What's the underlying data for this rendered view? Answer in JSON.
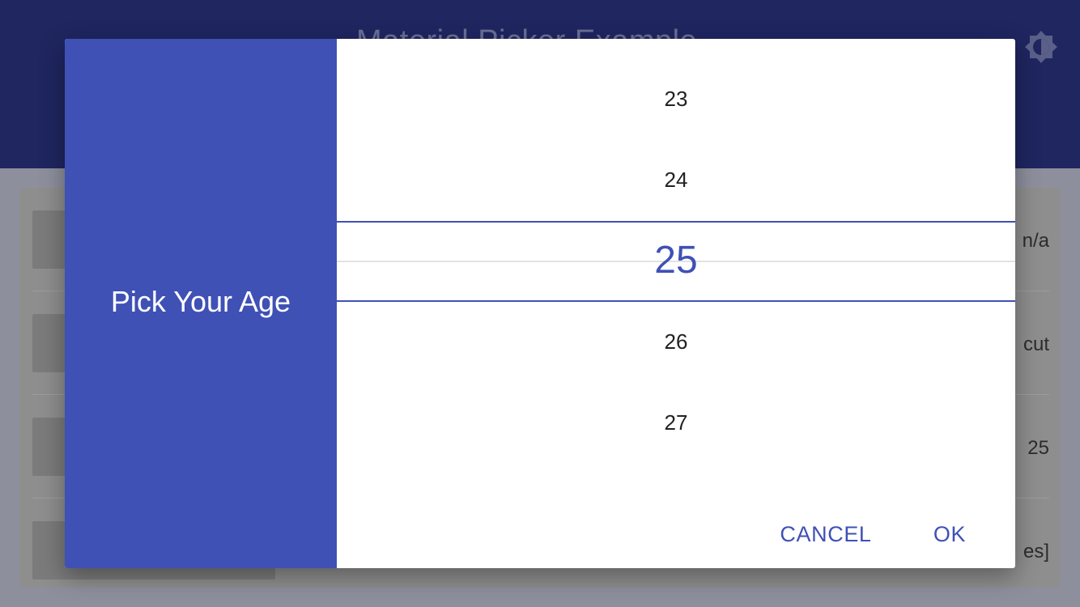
{
  "app": {
    "title": "Material Picker Example",
    "theme_toggle_icon": "brightness-icon"
  },
  "background_rows": [
    {
      "value": "n/a"
    },
    {
      "value": "cut"
    },
    {
      "value": "25"
    },
    {
      "value": "es]"
    }
  ],
  "dialog": {
    "title": "Pick Your Age",
    "accent_color": "#3f51b5",
    "picker": {
      "items": [
        "23",
        "24",
        "25",
        "26",
        "27"
      ],
      "selected": "25"
    },
    "actions": {
      "cancel_label": "CANCEL",
      "ok_label": "OK"
    }
  }
}
